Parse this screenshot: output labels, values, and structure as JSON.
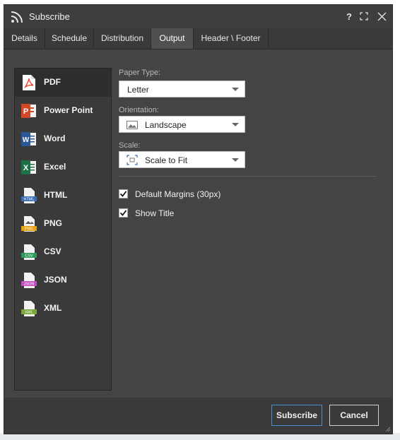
{
  "window": {
    "title": "Subscribe",
    "help_label": "?"
  },
  "tabs": [
    {
      "label": "Details",
      "active": false
    },
    {
      "label": "Schedule",
      "active": false
    },
    {
      "label": "Distribution",
      "active": false
    },
    {
      "label": "Output",
      "active": true
    },
    {
      "label": "Header \\ Footer",
      "active": false
    }
  ],
  "formats": [
    {
      "label": "PDF",
      "icon": "pdf-icon",
      "selected": true
    },
    {
      "label": "Power Point",
      "icon": "powerpoint-icon",
      "selected": false
    },
    {
      "label": "Word",
      "icon": "word-icon",
      "selected": false
    },
    {
      "label": "Excel",
      "icon": "excel-icon",
      "selected": false
    },
    {
      "label": "HTML",
      "icon": "html-icon",
      "selected": false
    },
    {
      "label": "PNG",
      "icon": "png-icon",
      "selected": false
    },
    {
      "label": "CSV",
      "icon": "csv-icon",
      "selected": false
    },
    {
      "label": "JSON",
      "icon": "json-icon",
      "selected": false
    },
    {
      "label": "XML",
      "icon": "xml-icon",
      "selected": false
    }
  ],
  "icon_text": {
    "html": "HTML",
    "png": "PNG",
    "csv": "CSV",
    "json": "JSON",
    "xml": "XML",
    "powerpoint": "P",
    "word": "W",
    "excel": "X"
  },
  "output": {
    "paper_type": {
      "label": "Paper Type:",
      "value": "Letter"
    },
    "orientation": {
      "label": "Orientation:",
      "value": "Landscape",
      "icon": "landscape-icon"
    },
    "scale": {
      "label": "Scale:",
      "value": "Scale to Fit",
      "icon": "scale-to-fit-icon"
    },
    "default_margins": {
      "label": "Default Margins (30px)",
      "checked": true
    },
    "show_title": {
      "label": "Show Title",
      "checked": true
    }
  },
  "footer": {
    "subscribe_label": "Subscribe",
    "cancel_label": "Cancel"
  },
  "colors": {
    "pdf": "#e8412c",
    "powerpoint": "#d24726",
    "word": "#2b5797",
    "excel": "#1e7145",
    "html": "#3b6fb6",
    "png": "#e6a117",
    "csv": "#2e9a5a",
    "json": "#c64fc0",
    "xml": "#7aa83a",
    "primary_border": "#4a90d9"
  }
}
